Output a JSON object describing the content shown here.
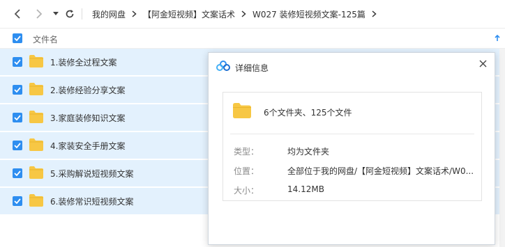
{
  "toolbar": {
    "back_icon": "chevron-left-icon",
    "forward_icon": "chevron-right-icon",
    "history_icon": "caret-down-icon",
    "refresh_icon": "refresh-icon"
  },
  "breadcrumb": {
    "items": [
      "我的网盘",
      "【阿金短视频】文案话术",
      "W027 装修短视频文案-125篇"
    ],
    "separator_icon": "chevron-right-icon"
  },
  "file_list": {
    "header_label": "文件名",
    "sort_icon": "arrow-up-icon",
    "items": [
      {
        "name": "1.装修全过程文案",
        "checked": true
      },
      {
        "name": "2.装修经验分享文案",
        "checked": true
      },
      {
        "name": "3.家庭装修知识文案",
        "checked": true
      },
      {
        "name": "4.家装安全手册文案",
        "checked": true
      },
      {
        "name": "5.采购解说短视频文案",
        "checked": true
      },
      {
        "name": "6.装修常识短视频文案",
        "checked": true
      }
    ]
  },
  "dialog": {
    "title": "详细信息",
    "summary": "6个文件夹、125个文件",
    "fields": [
      {
        "label": "类型：",
        "value": "均为文件夹"
      },
      {
        "label": "位置：",
        "value": "全部位于我的网盘/【阿金短视频】文案话术/W0..."
      },
      {
        "label": "大小：",
        "value": "14.12MB"
      }
    ]
  },
  "colors": {
    "accent": "#2e8ef0",
    "selected_row": "#e3f1fd",
    "folder": "#f7c744"
  }
}
